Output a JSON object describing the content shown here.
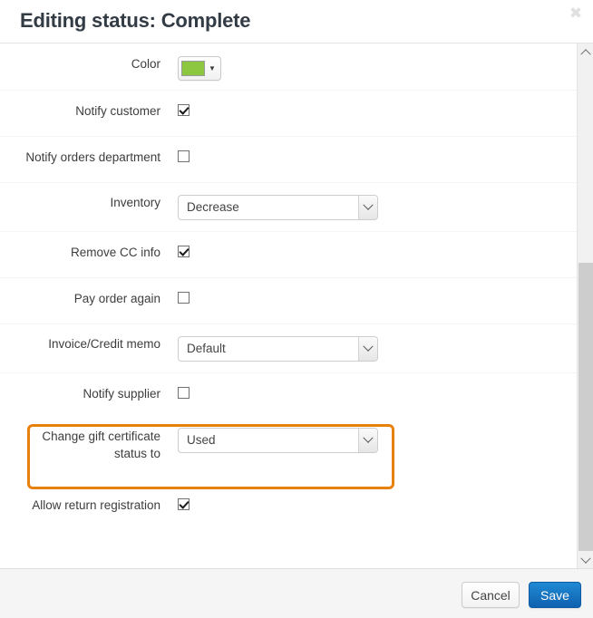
{
  "dialog": {
    "title": "Editing status: Complete",
    "close_label": "✖"
  },
  "form": {
    "rows": [
      {
        "label": "Color",
        "type": "color",
        "value": "#8dc63f"
      },
      {
        "label": "Notify customer",
        "type": "checkbox",
        "checked": true
      },
      {
        "label": "Notify orders department",
        "type": "checkbox",
        "checked": false
      },
      {
        "label": "Inventory",
        "type": "select",
        "value": "Decrease"
      },
      {
        "label": "Remove CC info",
        "type": "checkbox",
        "checked": true
      },
      {
        "label": "Pay order again",
        "type": "checkbox",
        "checked": false
      },
      {
        "label": "Invoice/Credit memo",
        "type": "select",
        "value": "Default"
      },
      {
        "label": "Notify supplier",
        "type": "checkbox",
        "checked": false
      },
      {
        "label": "Change gift certificate\nstatus to",
        "type": "select",
        "value": "Used",
        "highlighted": true
      },
      {
        "label": "Allow return registration",
        "type": "checkbox",
        "checked": true
      }
    ]
  },
  "footer": {
    "cancel_label": "Cancel",
    "save_label": "Save"
  },
  "colors": {
    "highlight_border": "#e8800c",
    "save_button": "#1070bc",
    "color_swatch": "#8dc63f",
    "title_text": "#333b45"
  },
  "scrollbar": {
    "up_icon": "chevron-up-icon",
    "down_icon": "chevron-down-icon"
  }
}
